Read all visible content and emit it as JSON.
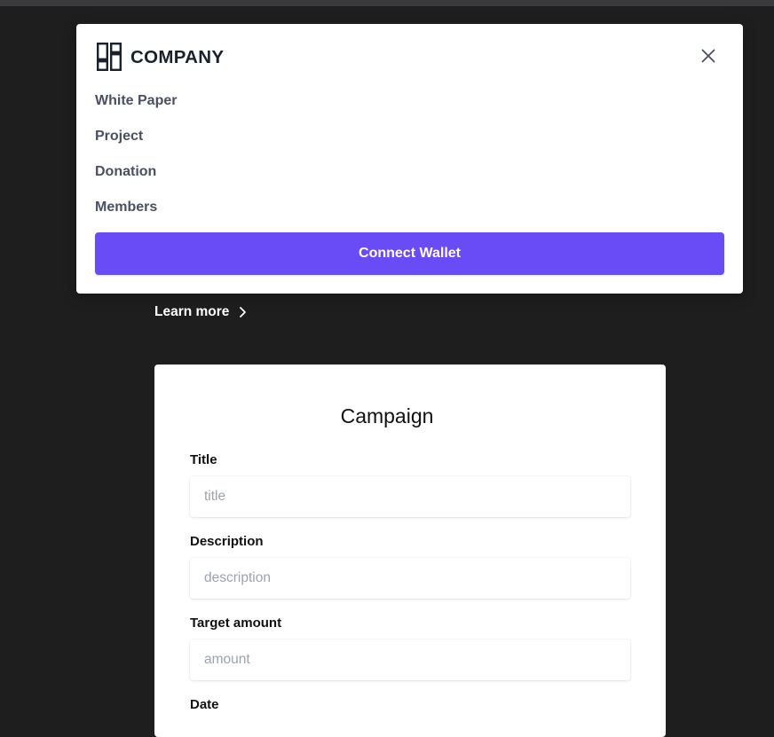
{
  "colors": {
    "page_background": "#1e1e1e",
    "panel_background": "#ffffff",
    "accent": "#6a4cf6",
    "nav_text": "#4a5063"
  },
  "nav": {
    "brand": "COMPANY",
    "logo_icon": "dashboard-grid-icon",
    "close_icon": "close-icon",
    "links": [
      {
        "label": "White Paper"
      },
      {
        "label": "Project"
      },
      {
        "label": "Donation"
      },
      {
        "label": "Members"
      }
    ],
    "connect_label": "Connect Wallet"
  },
  "hero": {
    "learn_more_label": "Learn more",
    "learn_more_icon": "chevron-right-icon"
  },
  "campaign": {
    "heading": "Campaign",
    "fields": [
      {
        "label": "Title",
        "placeholder": "title",
        "value": ""
      },
      {
        "label": "Description",
        "placeholder": "description",
        "value": ""
      },
      {
        "label": "Target amount",
        "placeholder": "amount",
        "value": ""
      },
      {
        "label": "Date"
      }
    ]
  }
}
